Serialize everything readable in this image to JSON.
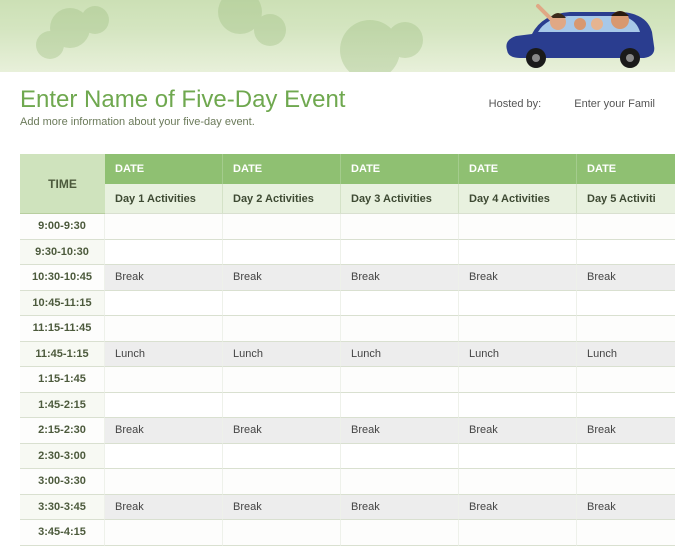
{
  "title": "Enter Name of Five-Day Event",
  "subtitle": "Add more information about your five-day event.",
  "hosted_by_label": "Hosted by:",
  "hosted_by_value": "Enter your Famil",
  "time_header": "TIME",
  "date_header": "DATE",
  "days": [
    "Day 1 Activities",
    "Day 2 Activities",
    "Day 3 Activities",
    "Day 4 Activities",
    "Day 5 Activiti"
  ],
  "rows": [
    {
      "time": "9:00-9:30",
      "cells": [
        "",
        "",
        "",
        "",
        ""
      ],
      "shade": false
    },
    {
      "time": "9:30-10:30",
      "cells": [
        "",
        "",
        "",
        "",
        ""
      ],
      "shade": false
    },
    {
      "time": "10:30-10:45",
      "cells": [
        "Break",
        "Break",
        "Break",
        "Break",
        "Break"
      ],
      "shade": true
    },
    {
      "time": "10:45-11:15",
      "cells": [
        "",
        "",
        "",
        "",
        ""
      ],
      "shade": false
    },
    {
      "time": "11:15-11:45",
      "cells": [
        "",
        "",
        "",
        "",
        ""
      ],
      "shade": false
    },
    {
      "time": "11:45-1:15",
      "cells": [
        "Lunch",
        "Lunch",
        "Lunch",
        "Lunch",
        "Lunch"
      ],
      "shade": true
    },
    {
      "time": "1:15-1:45",
      "cells": [
        "",
        "",
        "",
        "",
        ""
      ],
      "shade": false
    },
    {
      "time": "1:45-2:15",
      "cells": [
        "",
        "",
        "",
        "",
        ""
      ],
      "shade": false
    },
    {
      "time": "2:15-2:30",
      "cells": [
        "Break",
        "Break",
        "Break",
        "Break",
        "Break"
      ],
      "shade": true
    },
    {
      "time": "2:30-3:00",
      "cells": [
        "",
        "",
        "",
        "",
        ""
      ],
      "shade": false
    },
    {
      "time": "3:00-3:30",
      "cells": [
        "",
        "",
        "",
        "",
        ""
      ],
      "shade": false
    },
    {
      "time": "3:30-3:45",
      "cells": [
        "Break",
        "Break",
        "Break",
        "Break",
        "Break"
      ],
      "shade": true
    },
    {
      "time": "3:45-4:15",
      "cells": [
        "",
        "",
        "",
        "",
        ""
      ],
      "shade": false
    }
  ]
}
